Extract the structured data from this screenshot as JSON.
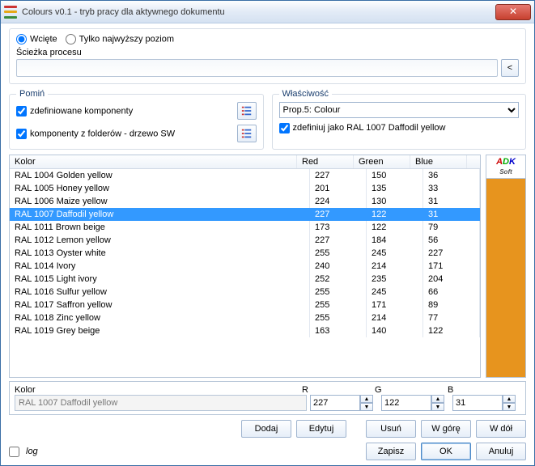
{
  "window": {
    "title": "Colours v0.1 - tryb pracy dla aktywnego dokumentu"
  },
  "mode": {
    "indented": "Wcięte",
    "top_only": "Tylko najwyższy poziom"
  },
  "path": {
    "label": "Ścieżka procesu",
    "browse": "<"
  },
  "skip": {
    "legend": "Pomiń",
    "defined": "zdefiniowane komponenty",
    "tree": "komponenty z folderów - drzewo SW"
  },
  "prop": {
    "legend": "Właściwość",
    "value": "Prop.5: Colour",
    "define_as": "zdefiniuj jako RAL 1007 Daffodil yellow"
  },
  "table": {
    "headers": {
      "name": "Kolor",
      "r": "Red",
      "g": "Green",
      "b": "Blue"
    },
    "rows": [
      {
        "name": "RAL 1004 Golden yellow",
        "r": 227,
        "g": 150,
        "b": 36
      },
      {
        "name": "RAL 1005 Honey yellow",
        "r": 201,
        "g": 135,
        "b": 33
      },
      {
        "name": "RAL 1006 Maize yellow",
        "r": 224,
        "g": 130,
        "b": 31
      },
      {
        "name": "RAL 1007 Daffodil yellow",
        "r": 227,
        "g": 122,
        "b": 31,
        "selected": true
      },
      {
        "name": "RAL 1011 Brown beige",
        "r": 173,
        "g": 122,
        "b": 79
      },
      {
        "name": "RAL 1012 Lemon yellow",
        "r": 227,
        "g": 184,
        "b": 56
      },
      {
        "name": "RAL 1013 Oyster white",
        "r": 255,
        "g": 245,
        "b": 227
      },
      {
        "name": "RAL 1014 Ivory",
        "r": 240,
        "g": 214,
        "b": 171
      },
      {
        "name": "RAL 1015 Light ivory",
        "r": 252,
        "g": 235,
        "b": 204
      },
      {
        "name": "RAL 1016 Sulfur yellow",
        "r": 255,
        "g": 245,
        "b": 66
      },
      {
        "name": "RAL 1017 Saffron yellow",
        "r": 255,
        "g": 171,
        "b": 89
      },
      {
        "name": "RAL 1018 Zinc yellow",
        "r": 255,
        "g": 214,
        "b": 77
      },
      {
        "name": "RAL 1019 Grey beige",
        "r": 163,
        "g": 140,
        "b": 122
      }
    ]
  },
  "detail": {
    "name_label": "Kolor",
    "r_label": "R",
    "g_label": "G",
    "b_label": "B",
    "name": "RAL 1007 Daffodil yellow",
    "r": "227",
    "g": "122",
    "b": "31"
  },
  "buttons": {
    "add": "Dodaj",
    "edit": "Edytuj",
    "delete": "Usuń",
    "up": "W górę",
    "down": "W dół",
    "save": "Zapisz",
    "ok": "OK",
    "cancel": "Anuluj"
  },
  "log": "log",
  "brand": {
    "a": "A",
    "d": "D",
    "k": "K",
    "rest": "Soft"
  }
}
